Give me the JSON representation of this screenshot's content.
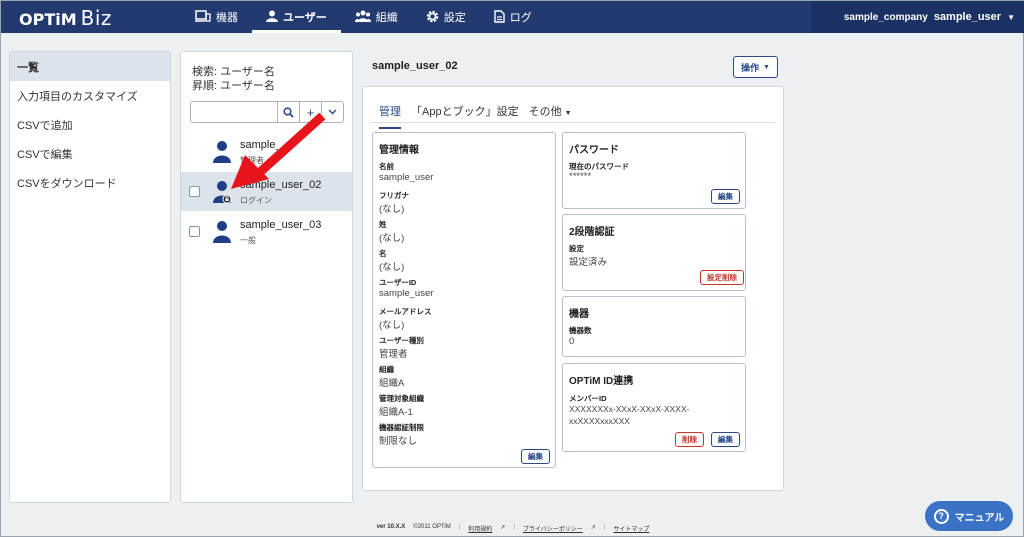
{
  "header": {
    "logo_main": "OPTiM",
    "logo_sub": "Biz",
    "nav": [
      {
        "label": "機器",
        "icon": "device-icon"
      },
      {
        "label": "ユーザー",
        "icon": "user-icon"
      },
      {
        "label": "組織",
        "icon": "group-icon"
      },
      {
        "label": "設定",
        "icon": "gear-icon"
      },
      {
        "label": "ログ",
        "icon": "document-icon"
      }
    ],
    "active_nav": "ユーザー",
    "company": "sample_company",
    "user": "sample_user"
  },
  "sidebar": {
    "items": [
      {
        "label": "一覧"
      },
      {
        "label": "入力項目のカスタマイズ"
      },
      {
        "label": "CSVで追加"
      },
      {
        "label": "CSVで編集"
      },
      {
        "label": "CSVをダウンロード"
      }
    ]
  },
  "list": {
    "search_line": "検索: ユーザー名",
    "sort_line": "昇順: ユーザー名",
    "search_placeholder": "",
    "users": [
      {
        "name": "sample_",
        "role": "管理者",
        "checkbox": false
      },
      {
        "name": "sample_user_02",
        "role": "ログイン",
        "checkbox": true,
        "selected": true
      },
      {
        "name": "sample_user_03",
        "role": "一般",
        "checkbox": true
      }
    ]
  },
  "detail": {
    "title": "sample_user_02",
    "ops_label": "操作",
    "tabs": [
      "管理",
      "「Appとブック」設定",
      "その他"
    ],
    "management": {
      "title": "管理情報",
      "fields": [
        {
          "label": "名前",
          "value": "sample_user"
        },
        {
          "label": "フリガナ",
          "value": "(なし)"
        },
        {
          "label": "姓",
          "value": "(なし)"
        },
        {
          "label": "名",
          "value": "(なし)"
        },
        {
          "label": "ユーザーID",
          "value": "sample_user"
        },
        {
          "label": "メールアドレス",
          "value": "(なし)"
        },
        {
          "label": "ユーザー種別",
          "value": "管理者"
        },
        {
          "label": "組織",
          "value": "組織A"
        },
        {
          "label": "管理対象組織",
          "value": "組織A-1"
        },
        {
          "label": "機器認証制限",
          "value": "制限なし"
        }
      ],
      "edit_label": "編集"
    },
    "password": {
      "title": "パスワード",
      "label": "現在のパスワード",
      "value": "******",
      "edit_label": "編集"
    },
    "twofactor": {
      "title": "2段階認証",
      "label": "設定",
      "value": "設定済み",
      "delete_label": "設定削除"
    },
    "devices": {
      "title": "機器",
      "label": "機器数",
      "value": "0"
    },
    "optim_id": {
      "title": "OPTiM ID連携",
      "label": "メンバーID",
      "value_line1": "XXXXXXXx-XXxX-XXxX-XXXX-",
      "value_line2": "xxXXXXxxxXXX",
      "delete_label": "削除",
      "edit_label": "編集"
    }
  },
  "footer": {
    "version": "ver 10.X.X",
    "copyright": "©2011 OPTiM",
    "terms": "利用規約",
    "privacy": "プライバシーポリシー",
    "sitemap": "サイトマップ"
  },
  "manual_label": "マニュアル",
  "colors": {
    "topbar": "#223a70",
    "accent": "#2a4a8a",
    "danger": "#c0392b",
    "arrow": "#e8141c",
    "manual": "#3a72c5"
  }
}
